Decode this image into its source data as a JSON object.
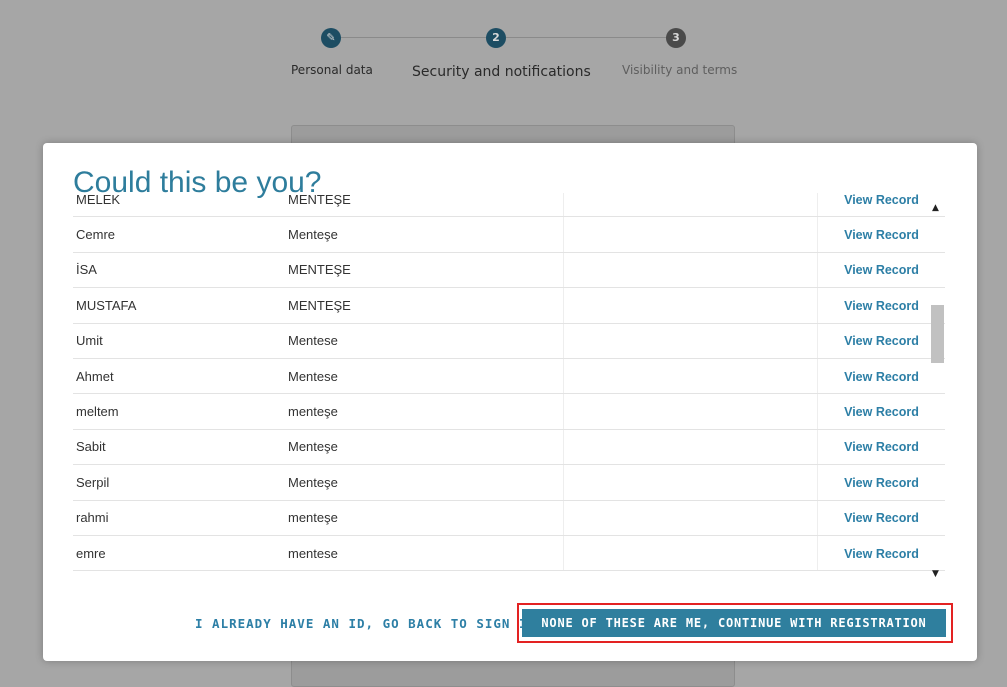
{
  "steps": [
    {
      "label": "Personal data",
      "marker": "✎"
    },
    {
      "label": "Security and notifications",
      "marker": "2"
    },
    {
      "label": "Visibility and terms",
      "marker": "3"
    }
  ],
  "modal": {
    "title": "Could this be you?",
    "rows": [
      {
        "first": "MELEK",
        "last": "MENTEŞE",
        "action": "View Record"
      },
      {
        "first": "Cemre",
        "last": "Menteşe",
        "action": "View Record"
      },
      {
        "first": "İSA",
        "last": "MENTEŞE",
        "action": "View Record"
      },
      {
        "first": "MUSTAFA",
        "last": "MENTEŞE",
        "action": "View Record"
      },
      {
        "first": "Umit",
        "last": "Mentese",
        "action": "View Record"
      },
      {
        "first": "Ahmet",
        "last": "Mentese",
        "action": "View Record"
      },
      {
        "first": "meltem",
        "last": "menteşe",
        "action": "View Record"
      },
      {
        "first": "Sabit",
        "last": "Menteşe",
        "action": "View Record"
      },
      {
        "first": "Serpil",
        "last": "Menteşe",
        "action": "View Record"
      },
      {
        "first": "rahmi",
        "last": "menteşe",
        "action": "View Record"
      },
      {
        "first": "emre",
        "last": "mentese",
        "action": "View Record"
      }
    ],
    "sign_in_label": "I ALREADY HAVE AN ID, GO BACK TO SIGN IN",
    "continue_label": "NONE OF THESE ARE ME, CONTINUE WITH REGISTRATION"
  },
  "colors": {
    "accent": "#2f7f9e",
    "link": "#2d7fa6",
    "highlight": "#e32222",
    "overlay": "#a6a6a6"
  }
}
